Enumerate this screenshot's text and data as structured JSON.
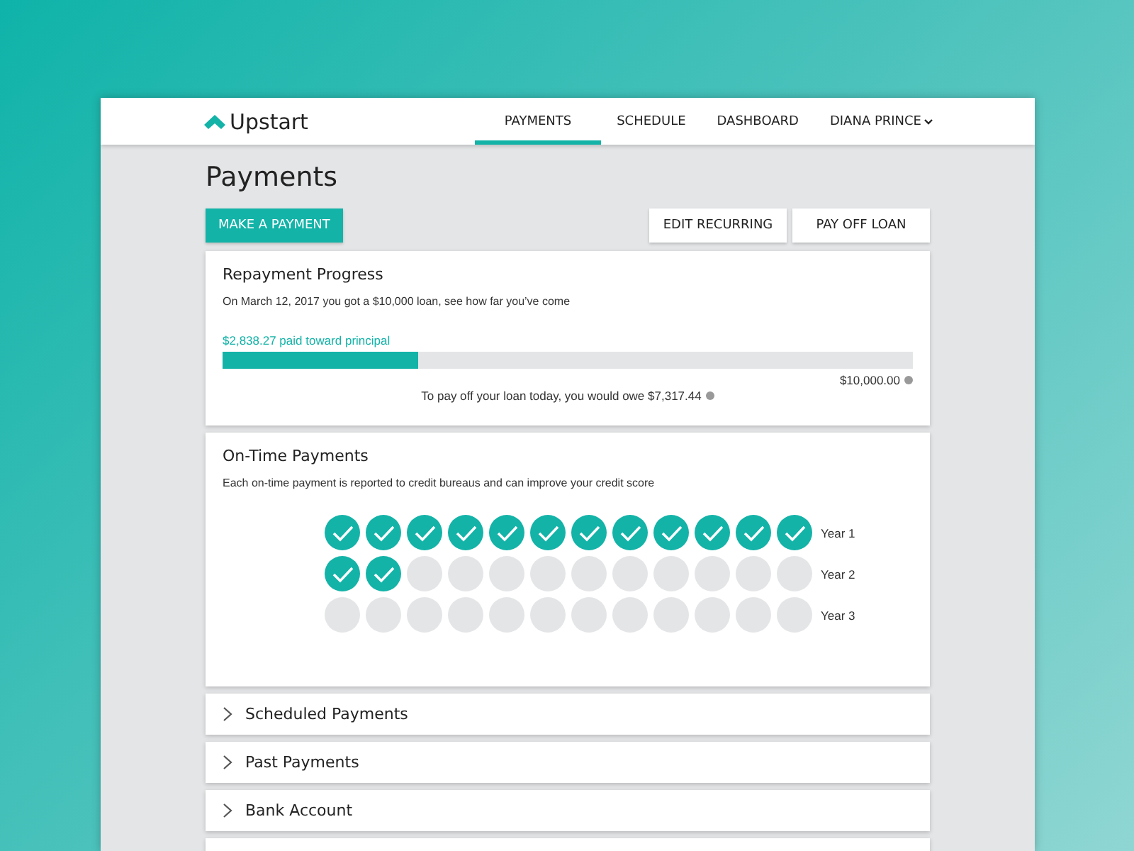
{
  "logo": "Upstart",
  "nav": [
    {
      "label": "PAYMENTS",
      "selected": true
    },
    {
      "label": "SCHEDULE",
      "selected": false
    },
    {
      "label": "DASHBOARD",
      "selected": false
    }
  ],
  "user_menu": "DIANA PRINCE",
  "title": "Payments",
  "primary_button": "MAKE A PAYMENT",
  "secondary_buttons": [
    "EDIT RECURRING",
    "PAY OFF LOAN"
  ],
  "progress": {
    "title": "Repayment Progress",
    "description": "On March 12, 2017 you got a $10,000 loan, see how far you’ve come",
    "paid_label": "$2,838.27 paid toward principal",
    "level": 0.284,
    "total": "$10,000.00",
    "payoff": "To pay off your loan today, you would owe $7,317.44"
  },
  "on_time": {
    "title": "On-Time Payments",
    "description": "Each on-time payment is reported to credit bureaus and can improve your credit score",
    "years": [
      {
        "label": "Year 1",
        "months": [
          {
            "paid": true
          },
          {
            "paid": true
          },
          {
            "paid": true
          },
          {
            "paid": true
          },
          {
            "paid": true
          },
          {
            "paid": true
          },
          {
            "paid": true
          },
          {
            "paid": true
          },
          {
            "paid": true
          },
          {
            "paid": true
          },
          {
            "paid": true
          },
          {
            "paid": true
          }
        ]
      },
      {
        "label": "Year 2",
        "months": [
          {
            "paid": true
          },
          {
            "paid": true
          },
          {
            "paid": false
          },
          {
            "paid": false
          },
          {
            "paid": false
          },
          {
            "paid": false
          },
          {
            "paid": false
          },
          {
            "paid": false
          },
          {
            "paid": false
          },
          {
            "paid": false
          },
          {
            "paid": false
          },
          {
            "paid": false
          }
        ]
      },
      {
        "label": "Year 3",
        "months": [
          {
            "paid": false
          },
          {
            "paid": false
          },
          {
            "paid": false
          },
          {
            "paid": false
          },
          {
            "paid": false
          },
          {
            "paid": false
          },
          {
            "paid": false
          },
          {
            "paid": false
          },
          {
            "paid": false
          },
          {
            "paid": false
          },
          {
            "paid": false
          },
          {
            "paid": false
          }
        ]
      }
    ]
  },
  "sections": [
    {
      "label": "Scheduled Payments",
      "expanded": false
    },
    {
      "label": "Past Payments",
      "expanded": false
    },
    {
      "label": "Bank Account",
      "expanded": false
    }
  ]
}
